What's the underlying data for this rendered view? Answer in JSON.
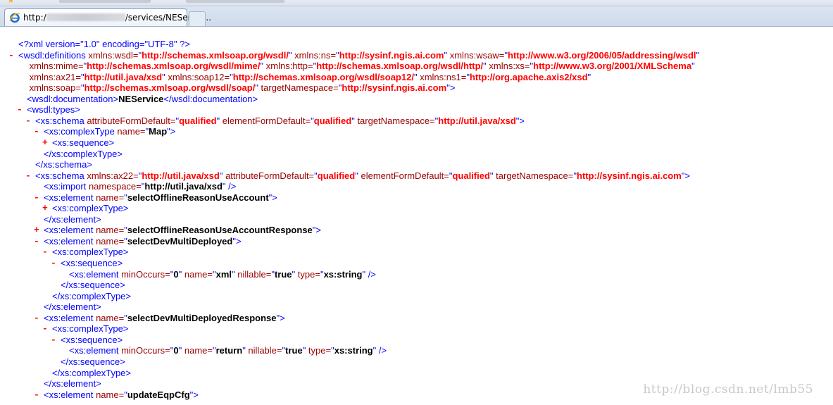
{
  "browser": {
    "tab_url_prefix": "http:/",
    "tab_url_suffix": "/services/NEServic..."
  },
  "xml": {
    "declaration": "<?xml version=\"1.0\" encoding=\"UTF-8\" ?>",
    "definitions": {
      "attrs": [
        [
          "xmlns:wsdl",
          "http://schemas.xmlsoap.org/wsdl/"
        ],
        [
          "xmlns:ns",
          "http://sysinf.ngis.ai.com"
        ],
        [
          "xmlns:wsaw",
          "http://www.w3.org/2006/05/addressing/wsdl"
        ],
        [
          "xmlns:mime",
          "http://schemas.xmlsoap.org/wsdl/mime/"
        ],
        [
          "xmlns:http",
          "http://schemas.xmlsoap.org/wsdl/http/"
        ],
        [
          "xmlns:xs",
          "http://www.w3.org/2001/XMLSchema"
        ],
        [
          "xmlns:ax21",
          "http://util.java/xsd"
        ],
        [
          "xmlns:soap12",
          "http://schemas.xmlsoap.org/wsdl/soap12/"
        ],
        [
          "xmlns:ns1",
          "http://org.apache.axis2/xsd"
        ],
        [
          "xmlns:soap",
          "http://schemas.xmlsoap.org/wsdl/soap/"
        ],
        [
          "targetNamespace",
          "http://sysinf.ngis.ai.com"
        ]
      ],
      "documentation": "NEService"
    },
    "schema1": {
      "attributeFormDefault": "qualified",
      "elementFormDefault": "qualified",
      "targetNamespace": "http://util.java/xsd",
      "complexType_name": "Map"
    },
    "schema2": {
      "xmlns_ax22": "http://util.java/xsd",
      "attributeFormDefault": "qualified",
      "elementFormDefault": "qualified",
      "targetNamespace": "http://sysinf.ngis.ai.com",
      "import_namespace": "http://util.java/xsd",
      "elements": [
        "selectOfflineReasonUseAccount",
        "selectOfflineReasonUseAccountResponse",
        "selectDevMultiDeployed",
        "selectDevMultiDeployedResponse",
        "updateEqpCfg"
      ],
      "field1": {
        "minOccurs": "0",
        "name": "xml",
        "nillable": "true",
        "type": "xs:string"
      },
      "field2": {
        "minOccurs": "0",
        "name": "return",
        "nillable": "true",
        "type": "xs:string"
      }
    }
  },
  "toggle": {
    "minus": "-",
    "plus": "+"
  },
  "watermark": "http://blog.csdn.net/lmb55",
  "colors": {
    "tag": "#0000ff",
    "attr_name": "#990000",
    "attr_value": "#ff0000",
    "text": "#000000"
  },
  "icons": {
    "favorites": "star-icon",
    "tab": "ie-icon"
  }
}
